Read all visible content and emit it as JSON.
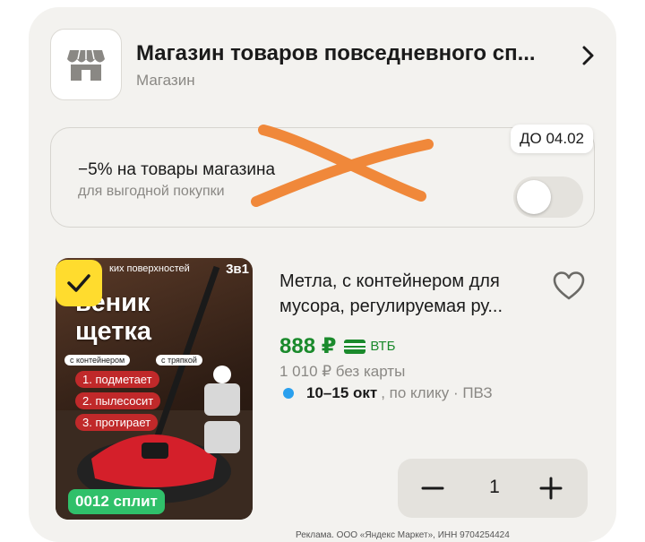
{
  "store": {
    "name": "Магазин товаров повседневного сп...",
    "type": "Магазин"
  },
  "promo": {
    "title": "−5% на товары магазина",
    "subtitle": "для выгодной покупки",
    "date_badge": "ДО 04.02",
    "toggle_on": false
  },
  "product": {
    "image_text": {
      "top_small": "ких поверхностей",
      "top_right": "3в1",
      "headline_1": "веник",
      "headline_2": "щетка",
      "pill_1": "с контейнером",
      "pill_2": "с тряпкой",
      "feature_1": "1. подметает",
      "feature_2": "2. пылесосит",
      "feature_3": "3. протирает"
    },
    "split_badge": "0012 сплит",
    "title": "Метла, с контейнером для мусора, регулируемая ру...",
    "price": "888 ₽",
    "bank": "ВТБ",
    "old_price": "1 010 ₽ без карты",
    "delivery_date": "10–15 окт",
    "delivery_rest": ", по клику · ПВЗ",
    "quantity": "1"
  },
  "ad_note": "Реклама. ООО «Яндекс Маркет», ИНН 9704254424",
  "colors": {
    "background": "#f3f2ef",
    "accent_yellow": "#ffdc2e",
    "price_green": "#1a8a2c",
    "split_green": "#30c06a",
    "delivery_dot": "#2aa0ee",
    "scribble": "#f0883a"
  },
  "icons": {
    "store": "shop-icon",
    "chevron": "chevron-right-icon",
    "favorite": "heart-icon",
    "selected": "check-icon",
    "bank": "card-icon"
  }
}
